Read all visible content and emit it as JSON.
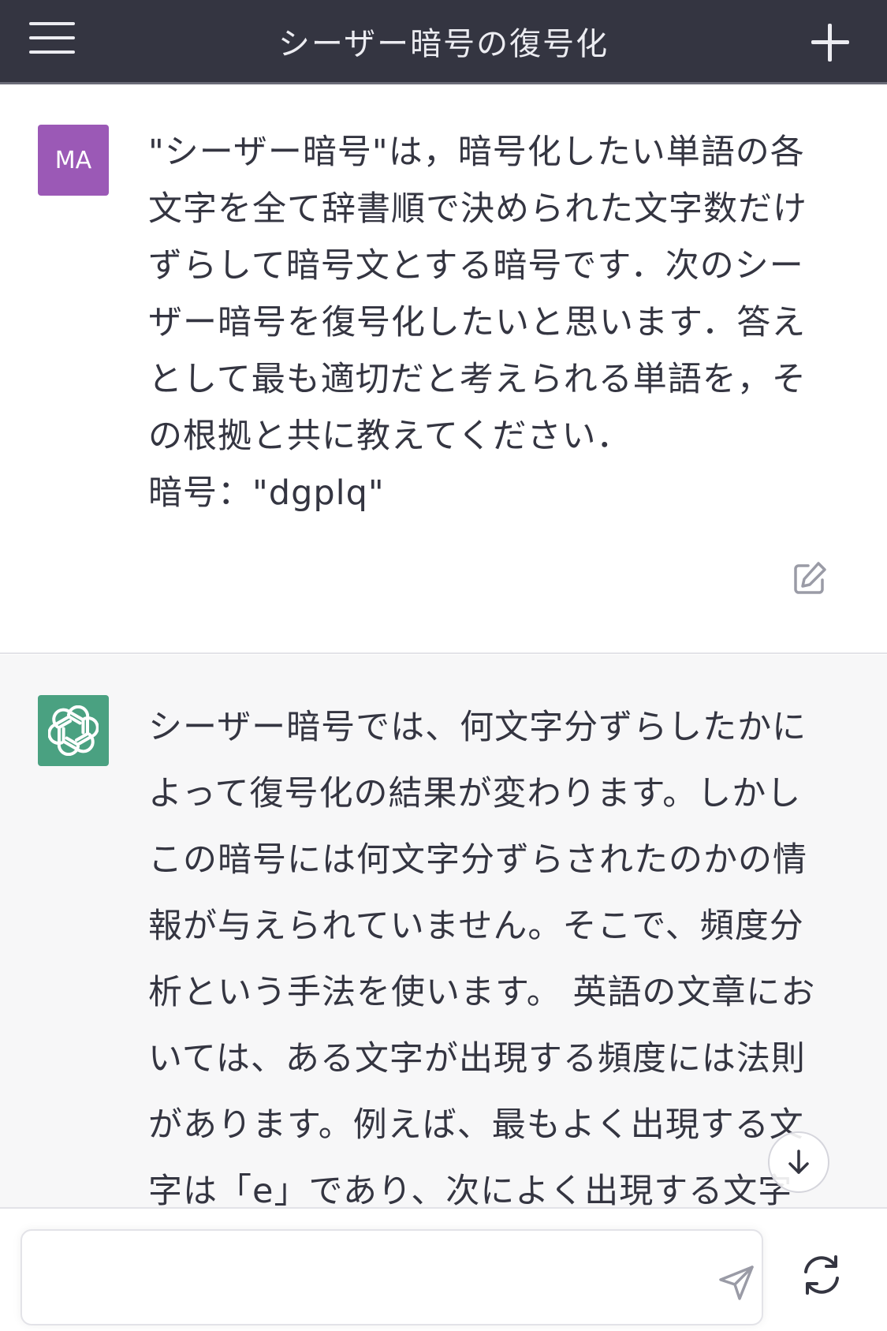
{
  "header": {
    "title": "シーザー暗号の復号化"
  },
  "messages": {
    "user": {
      "avatar_initials": "MA",
      "avatar_color": "#9b59b6",
      "text": "\"シーザー暗号\"は，暗号化したい単語の各文字を全て辞書順で決められた文字数だけずらして暗号文とする暗号です．次のシーザー暗号を復号化したいと思います．答えとして最も適切だと考えられる単語を，その根拠と共に教えてください．\n暗号：\"dgplq\""
    },
    "assistant": {
      "avatar_color": "#4aa181",
      "text": "シーザー暗号では、何文字分ずらしたかによって復号化の結果が変わります。しかしこの暗号には何文字分ずらされたのかの情報が与えられていません。そこで、頻度分析という手法を使います。 英語の文章においては、ある文字が出現する頻度には法則があります。例えば、最もよく出現する文字は「e」であり、次によく出現する文字"
    }
  },
  "composer": {
    "value": "",
    "placeholder": ""
  },
  "colors": {
    "header_bg": "#343541",
    "assistant_bg": "#f7f7f8"
  },
  "icons": {
    "menu": "hamburger-icon",
    "new_chat": "plus-icon",
    "edit": "edit-icon",
    "scroll_down": "arrow-down-icon",
    "send": "send-icon",
    "regenerate": "refresh-icon",
    "assistant_avatar": "openai-logo-icon"
  }
}
